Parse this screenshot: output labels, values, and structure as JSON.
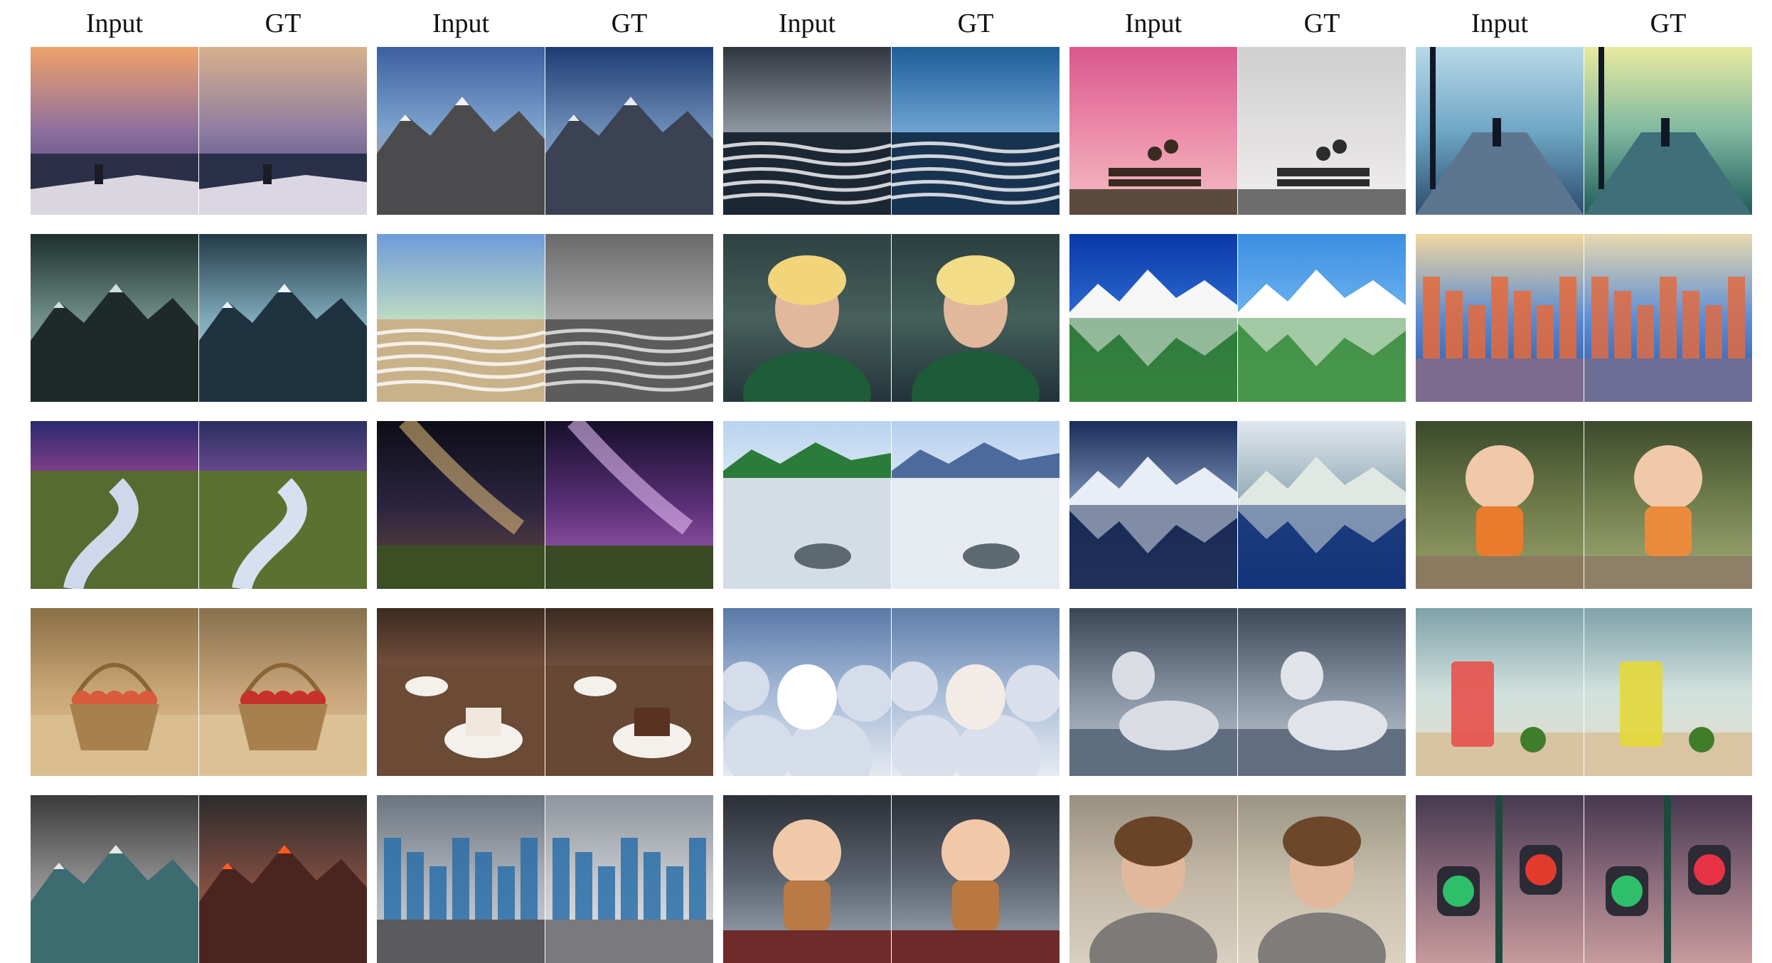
{
  "columns": [
    "Input",
    "GT",
    "Input",
    "GT",
    "Input",
    "GT",
    "Input",
    "GT",
    "Input",
    "GT"
  ],
  "rows": [
    [
      {
        "sky": [
          "#f0a26a",
          "#8e6f9e",
          "#353a70"
        ],
        "ground": "#2b3048",
        "accent": "#ece9f0",
        "mode": "lake"
      },
      {
        "sky": [
          "#d7b08c",
          "#8f7da2",
          "#343c70"
        ],
        "ground": "#2a2f4a",
        "accent": "#eeeaf3",
        "mode": "lake"
      },
      {
        "sky": [
          "#3d5f9f",
          "#7fa4cf",
          "#e28b5e"
        ],
        "ground": "#4b4b4e",
        "accent": "#f0f2f7",
        "mode": "mountain"
      },
      {
        "sky": [
          "#1e3c73",
          "#6d8db7",
          "#a6b8cf"
        ],
        "ground": "#3a4254",
        "accent": "#e4e9f2",
        "mode": "mountain"
      },
      {
        "sky": [
          "#30363f",
          "#8e96a0",
          "#d8dde2"
        ],
        "ground": "#1b2733",
        "accent": "#ffffff",
        "mode": "sea"
      },
      {
        "sky": [
          "#1d5d99",
          "#6ea3d1",
          "#c8dbe8"
        ],
        "ground": "#183350",
        "accent": "#ffffff",
        "mode": "sea"
      },
      {
        "sky": [
          "#d9588d",
          "#ec8aa9",
          "#f2c1c4"
        ],
        "ground": "#5c4a3e",
        "accent": "#3a2a22",
        "mode": "bench"
      },
      {
        "sky": [
          "#cfcfcf",
          "#e0dede",
          "#f2f0ef"
        ],
        "ground": "#6c6c6c",
        "accent": "#2d2d2d",
        "mode": "bench"
      },
      {
        "sky": [
          "#b8d8e6",
          "#6fa7c6",
          "#2b4b6d"
        ],
        "ground": "#5d7690",
        "accent": "#101828",
        "mode": "street"
      },
      {
        "sky": [
          "#e9ea9f",
          "#7fb8a0",
          "#1f5b5a"
        ],
        "ground": "#3f6f78",
        "accent": "#101828",
        "mode": "street"
      }
    ],
    [
      {
        "sky": [
          "#1c2f2c",
          "#6f8d86",
          "#9fbdb4"
        ],
        "ground": "#1d2a27",
        "accent": "#cde2dc",
        "mode": "mountain"
      },
      {
        "sky": [
          "#223a47",
          "#7ea7b8",
          "#c6dfe7"
        ],
        "ground": "#1f3240",
        "accent": "#e8f4f8",
        "mode": "mountain"
      },
      {
        "sky": [
          "#6e9bd9",
          "#bcd9c2",
          "#7fb5cc"
        ],
        "ground": "#c9b28a",
        "accent": "#ffffff",
        "mode": "sea"
      },
      {
        "sky": [
          "#6a6a6a",
          "#a4a4a4",
          "#d0d0d0"
        ],
        "ground": "#5c5c5c",
        "accent": "#efefef",
        "mode": "sea"
      },
      {
        "sky": [
          "#2d4242",
          "#48605c",
          "#25353a"
        ],
        "ground": "#1f5c3a",
        "accent": "#f2d57a",
        "mode": "portrait"
      },
      {
        "sky": [
          "#2a3f3f",
          "#44605a",
          "#22333a"
        ],
        "ground": "#1e5b39",
        "accent": "#f3dc88",
        "mode": "portrait"
      },
      {
        "sky": [
          "#0a38a8",
          "#2c6bd0",
          "#7fb3e8"
        ],
        "ground": "#2f7c2c",
        "accent": "#f6f6f6",
        "mode": "reflection"
      },
      {
        "sky": [
          "#3c8fe2",
          "#6db3ef",
          "#a8d5f5"
        ],
        "ground": "#3e8f36",
        "accent": "#ffffff",
        "mode": "reflection"
      },
      {
        "sky": [
          "#f0d7a0",
          "#5b8bd0",
          "#2a4f9a"
        ],
        "ground": "#7c6b8f",
        "accent": "#e86a3a",
        "mode": "city"
      },
      {
        "sky": [
          "#e7d9ad",
          "#5d8ed6",
          "#2a51a0"
        ],
        "ground": "#6d6e95",
        "accent": "#e06b42",
        "mode": "city"
      }
    ],
    [
      {
        "sky": [
          "#2b2a6f",
          "#b24d9a",
          "#f2a04f"
        ],
        "ground": "#556b2f",
        "accent": "#cfd8ea",
        "mode": "river"
      },
      {
        "sky": [
          "#2c2f62",
          "#8a5aa6",
          "#e0a07a"
        ],
        "ground": "#5c7130",
        "accent": "#d8dff0",
        "mode": "river"
      },
      {
        "sky": [
          "#0d0d16",
          "#2b2440",
          "#6b4b3a"
        ],
        "ground": "#3c4f24",
        "accent": "#e7c27b",
        "mode": "galaxy"
      },
      {
        "sky": [
          "#15102a",
          "#5a2f77",
          "#b066c0"
        ],
        "ground": "#3a4a24",
        "accent": "#f0c8ff",
        "mode": "galaxy"
      },
      {
        "sky": [
          "#b9d3ef",
          "#e7f0f8",
          "#3f9ccf"
        ],
        "ground": "#d4dde6",
        "accent": "#2b7c3a",
        "mode": "beach"
      },
      {
        "sky": [
          "#b5cfee",
          "#e7eef7",
          "#4f8ec7"
        ],
        "ground": "#e6ebf2",
        "accent": "#4c6b9c",
        "mode": "beach"
      },
      {
        "sky": [
          "#1a2d5c",
          "#7d94b8",
          "#c2cddd"
        ],
        "ground": "#0d1f4a",
        "accent": "#e8eef6",
        "mode": "reflection"
      },
      {
        "sky": [
          "#e1e7ee",
          "#8ea8b2",
          "#2d4f7a"
        ],
        "ground": "#11317a",
        "accent": "#dfe8e2",
        "mode": "reflection"
      },
      {
        "sky": [
          "#3a4a2c",
          "#6f7a4a",
          "#9aa36b"
        ],
        "ground": "#8b7a60",
        "accent": "#e97c2c",
        "mode": "toy"
      },
      {
        "sky": [
          "#3c4a2d",
          "#72804e",
          "#a5ad78"
        ],
        "ground": "#8f7f66",
        "accent": "#ec8a3c",
        "mode": "toy"
      }
    ],
    [
      {
        "sky": [
          "#8b7046",
          "#c9a676",
          "#e5c79a"
        ],
        "ground": "#d9bd8f",
        "accent": "#d85b3c",
        "mode": "basket"
      },
      {
        "sky": [
          "#86704c",
          "#c7a57a",
          "#e4c8a0"
        ],
        "ground": "#dcc197",
        "accent": "#c7312c",
        "mode": "basket"
      },
      {
        "sky": [
          "#3c2a20",
          "#8a6048",
          "#d7b89a"
        ],
        "ground": "#6b4a36",
        "accent": "#f0e8dd",
        "mode": "table"
      },
      {
        "sky": [
          "#3c2a20",
          "#86604a",
          "#d2b59a"
        ],
        "ground": "#674834",
        "accent": "#5a3222",
        "mode": "table"
      },
      {
        "sky": [
          "#5a79a8",
          "#a4b9d6",
          "#e4e9f1"
        ],
        "ground": "#d5dcea",
        "accent": "#ffffff",
        "mode": "cloud"
      },
      {
        "sky": [
          "#5f7ea9",
          "#a8bcd7",
          "#e6ebf2"
        ],
        "ground": "#d9dfeb",
        "accent": "#f3ece6",
        "mode": "cloud"
      },
      {
        "sky": [
          "#3b4655",
          "#8390a0",
          "#c8cfd7"
        ],
        "ground": "#5f6d80",
        "accent": "#d9dde3",
        "mode": "animal"
      },
      {
        "sky": [
          "#3d4858",
          "#8592a2",
          "#cad1d9"
        ],
        "ground": "#606e80",
        "accent": "#e0e3e8",
        "mode": "animal"
      },
      {
        "sky": [
          "#7fa1a8",
          "#cfe0dc",
          "#e5dccc"
        ],
        "ground": "#d8c4a2",
        "accent": "#e8514b",
        "mode": "drink"
      },
      {
        "sky": [
          "#7fa2a9",
          "#d0e1dd",
          "#e6ddcd"
        ],
        "ground": "#d9c5a3",
        "accent": "#e3d83a",
        "mode": "drink"
      }
    ],
    [
      {
        "sky": [
          "#3a3a3a",
          "#8c8c8c",
          "#d0d0d0"
        ],
        "ground": "#3c6c70",
        "accent": "#e7e7e7",
        "mode": "mountain"
      },
      {
        "sky": [
          "#2c2c2c",
          "#7a4b40",
          "#b46a4e"
        ],
        "ground": "#4a2520",
        "accent": "#ff5a1e",
        "mode": "mountain"
      },
      {
        "sky": [
          "#6c7480",
          "#a9b0b8",
          "#d3d7dc"
        ],
        "ground": "#5b5a5e",
        "accent": "#2c6fa8",
        "mode": "city"
      },
      {
        "sky": [
          "#8f959d",
          "#c4c8cd",
          "#e2e4e7"
        ],
        "ground": "#7a7a7e",
        "accent": "#2c6fa8",
        "mode": "city"
      },
      {
        "sky": [
          "#2b2f36",
          "#5c6470",
          "#a8b1bd"
        ],
        "ground": "#6e2b2a",
        "accent": "#b97a45",
        "mode": "toy"
      },
      {
        "sky": [
          "#2c3037",
          "#5d6571",
          "#a9b2be"
        ],
        "ground": "#6c2a29",
        "accent": "#b8783f",
        "mode": "toy"
      },
      {
        "sky": [
          "#9a9080",
          "#c3b8a6",
          "#d8cfc0"
        ],
        "ground": "#7d7a78",
        "accent": "#6a4428",
        "mode": "portrait"
      },
      {
        "sky": [
          "#9a9585",
          "#c6bda9",
          "#dbd2c2"
        ],
        "ground": "#7f7c7a",
        "accent": "#6c472a",
        "mode": "portrait"
      },
      {
        "sky": [
          "#463a4f",
          "#8a6a7a",
          "#c59a9c"
        ],
        "ground": "#2b2b36",
        "accent": "#e23b2e",
        "mode": "light"
      },
      {
        "sky": [
          "#47384f",
          "#8b6a7b",
          "#c69b9d"
        ],
        "ground": "#2c2b36",
        "accent": "#e83347",
        "mode": "light"
      }
    ]
  ]
}
